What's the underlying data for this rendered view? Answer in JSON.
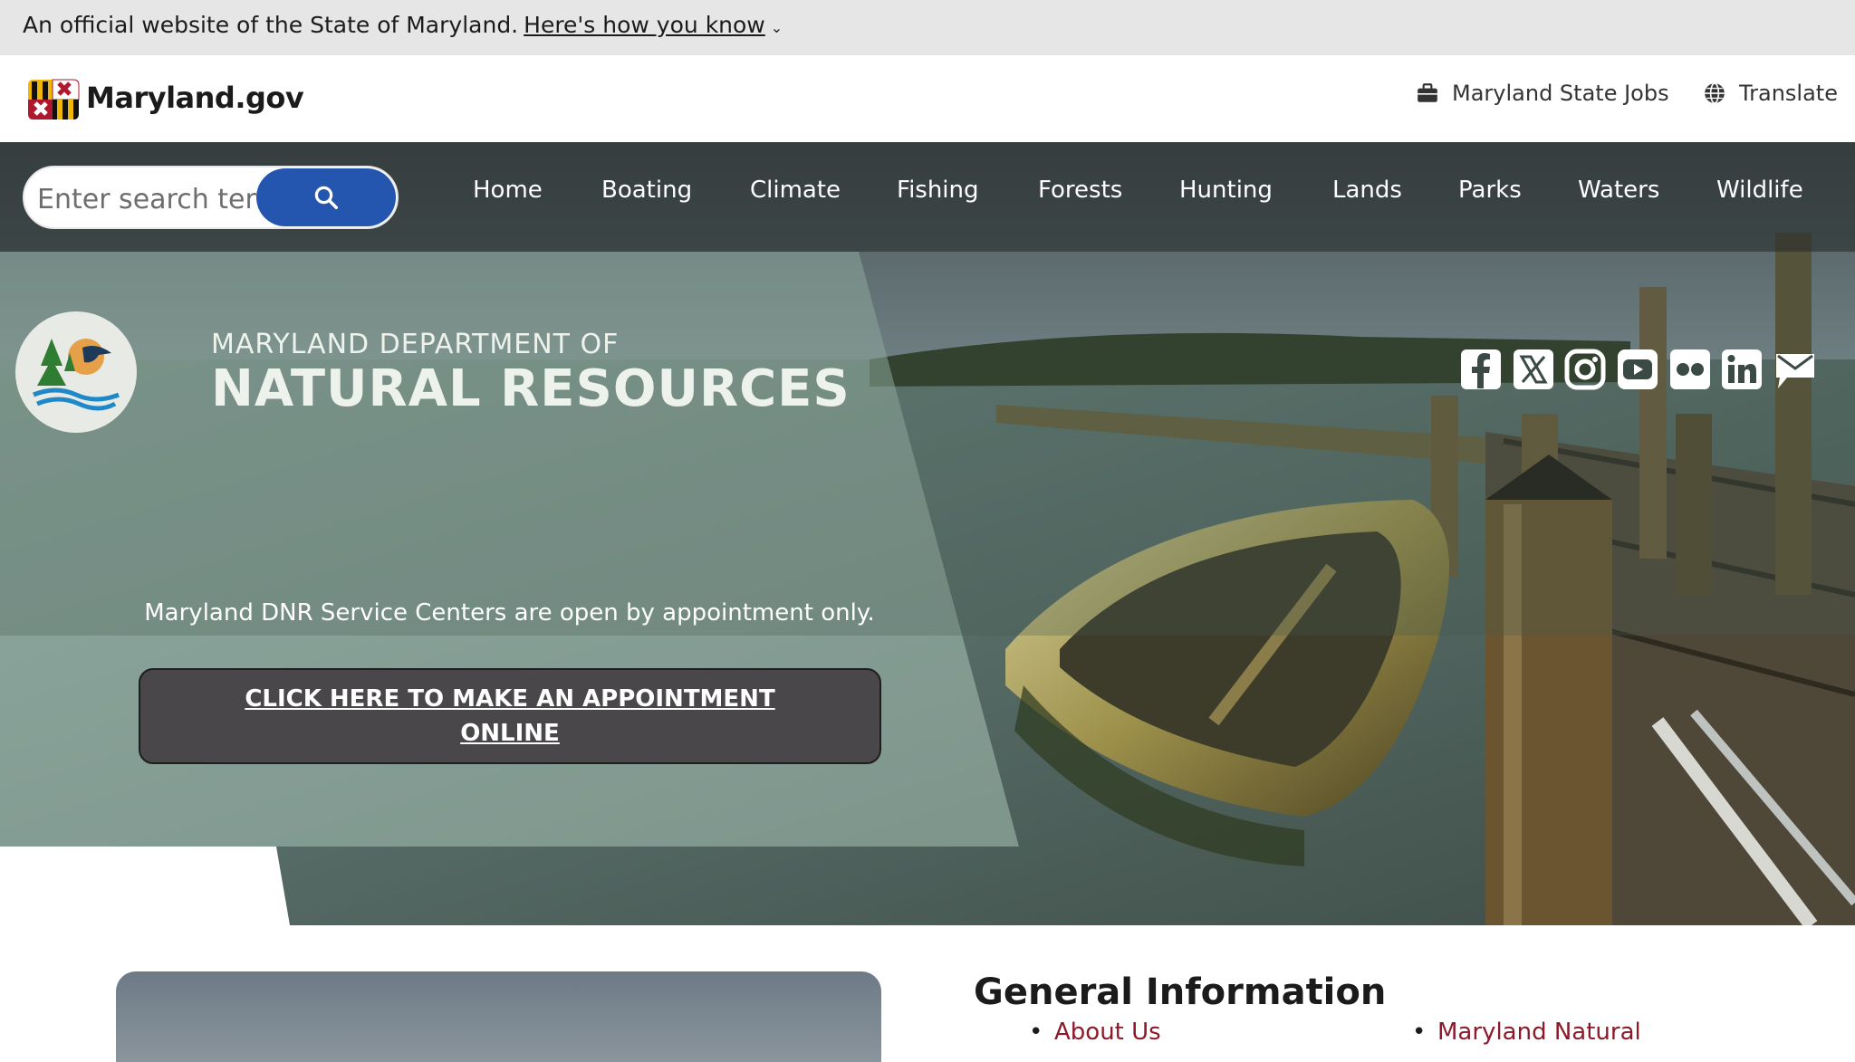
{
  "banner": {
    "text": "An official website of the State of Maryland.",
    "link": "Here's how you know"
  },
  "header": {
    "site_name": "Maryland.gov",
    "jobs_label": "Maryland State Jobs",
    "translate_label": "Translate"
  },
  "search": {
    "placeholder": "Enter search terms"
  },
  "nav": {
    "items": [
      "Home",
      "Boating",
      "Climate",
      "Fishing",
      "Forests",
      "Hunting",
      "Lands",
      "Parks",
      "Waters",
      "Wildlife"
    ]
  },
  "agency": {
    "line1": "MARYLAND DEPARTMENT OF",
    "line2": "NATURAL RESOURCES"
  },
  "social": {
    "icons": [
      "facebook-icon",
      "x-icon",
      "instagram-icon",
      "youtube-icon",
      "flickr-icon",
      "linkedin-icon",
      "email-icon"
    ]
  },
  "notice": {
    "text": "Maryland DNR Service Centers are open by appointment only.",
    "button": "CLICK HERE TO MAKE AN APPOINTMENT ONLINE"
  },
  "general_info": {
    "title": "General Information",
    "items": [
      "About Us",
      "Maryland Natural"
    ]
  },
  "colors": {
    "search_button": "#2456b0",
    "link": "#8b1a2b",
    "overlay": "#9fb7ac"
  }
}
